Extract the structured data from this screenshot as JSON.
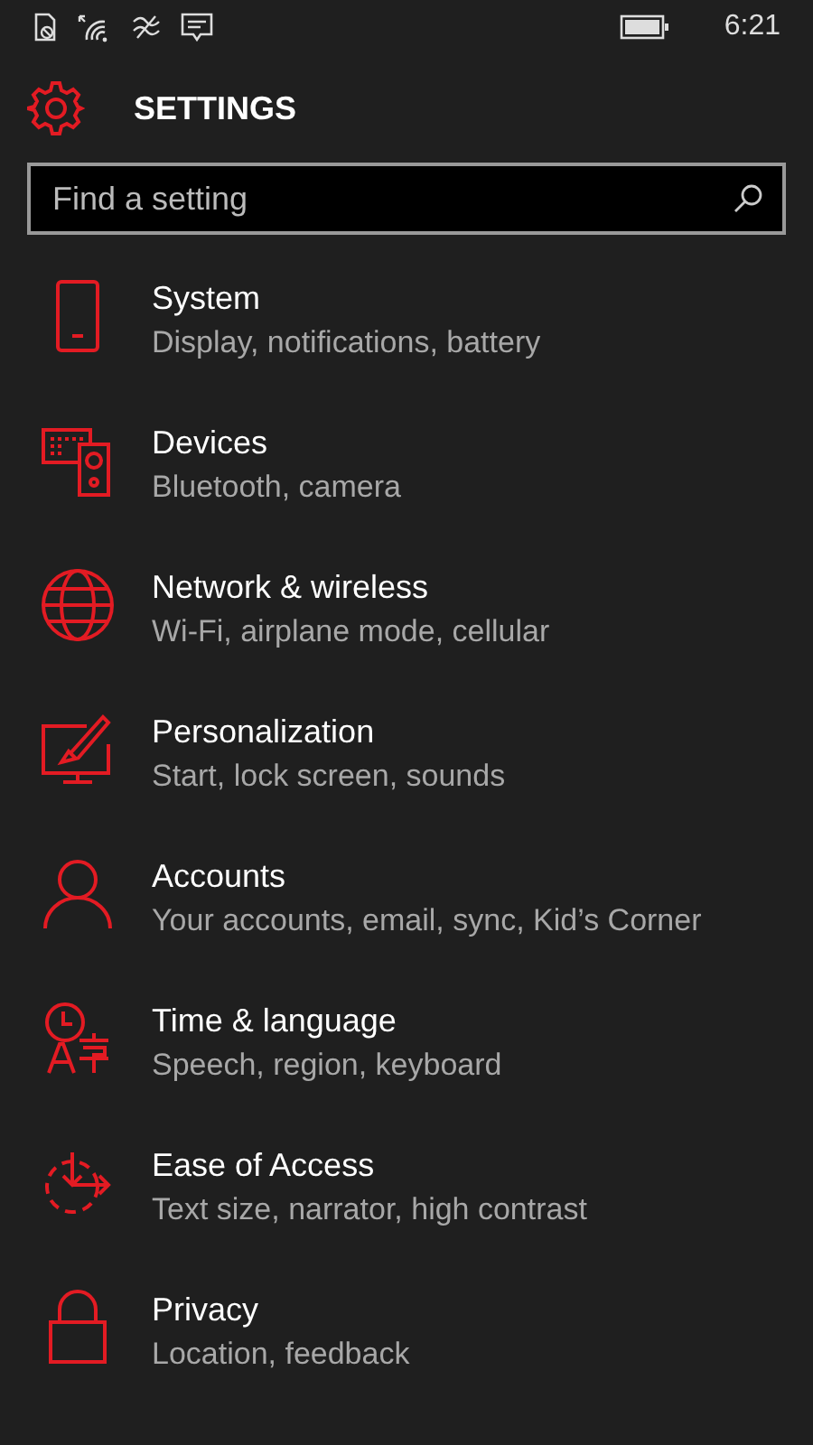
{
  "status_bar": {
    "time": "6:21"
  },
  "header": {
    "title": "SETTINGS"
  },
  "search": {
    "placeholder": "Find a setting"
  },
  "items": [
    {
      "kind": "system",
      "title": "System",
      "subtitle": "Display, notifications, battery"
    },
    {
      "kind": "devices",
      "title": "Devices",
      "subtitle": "Bluetooth, camera"
    },
    {
      "kind": "network",
      "title": "Network & wireless",
      "subtitle": "Wi-Fi, airplane mode, cellular"
    },
    {
      "kind": "personalization",
      "title": "Personalization",
      "subtitle": "Start, lock screen, sounds"
    },
    {
      "kind": "accounts",
      "title": "Accounts",
      "subtitle": "Your accounts, email, sync, Kid’s Corner"
    },
    {
      "kind": "time",
      "title": "Time & language",
      "subtitle": "Speech, region, keyboard"
    },
    {
      "kind": "ease",
      "title": "Ease of Access",
      "subtitle": "Text size, narrator, high contrast"
    },
    {
      "kind": "privacy",
      "title": "Privacy",
      "subtitle": "Location, feedback"
    }
  ]
}
